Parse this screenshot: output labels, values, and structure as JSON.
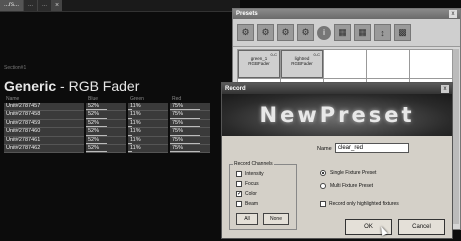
{
  "app": {
    "tabs": [
      "...rs...",
      "...",
      "..."
    ],
    "section_label": "Section#1",
    "fader_title_bold": "Generic",
    "fader_title_rest": " - RGB Fader",
    "columns": [
      "Name",
      "Blue",
      "Green",
      "Red"
    ],
    "rows": [
      {
        "name": "Unit#2787457",
        "blue": "52%",
        "green": "11%",
        "red": "75%"
      },
      {
        "name": "Unit#2787458",
        "blue": "52%",
        "green": "11%",
        "red": "75%"
      },
      {
        "name": "Unit#2787459",
        "blue": "52%",
        "green": "11%",
        "red": "75%"
      },
      {
        "name": "Unit#2787460",
        "blue": "52%",
        "green": "11%",
        "red": "75%"
      },
      {
        "name": "Unit#2787461",
        "blue": "52%",
        "green": "11%",
        "red": "75%"
      },
      {
        "name": "Unit#2787462",
        "blue": "52%",
        "green": "11%",
        "red": "75%"
      }
    ]
  },
  "presets": {
    "title": "Presets",
    "close": "x",
    "info_icon": "i",
    "tiles": [
      {
        "num": "0-C",
        "name": "green_1",
        "type": "RGBFader"
      },
      {
        "num": "0-C",
        "name": "lightred",
        "type": "RGBFader"
      }
    ]
  },
  "record": {
    "title": "Record",
    "close": "x",
    "banner": "NewPreset",
    "name_label": "Name",
    "name_value": "clear_red",
    "channels_legend": "Record Channels",
    "channels": [
      {
        "label": "Intensity",
        "checked": false
      },
      {
        "label": "Focus",
        "checked": false
      },
      {
        "label": "Color",
        "checked": true
      },
      {
        "label": "Beam",
        "checked": false
      }
    ],
    "all_label": "All",
    "none_label": "None",
    "single_fixture": "Single Fixture Preset",
    "multi_fixture": "Multi Fixture Preset",
    "only_highlighted": "Record only highlighted fixtures",
    "ok_label": "OK",
    "cancel_label": "Cancel"
  }
}
